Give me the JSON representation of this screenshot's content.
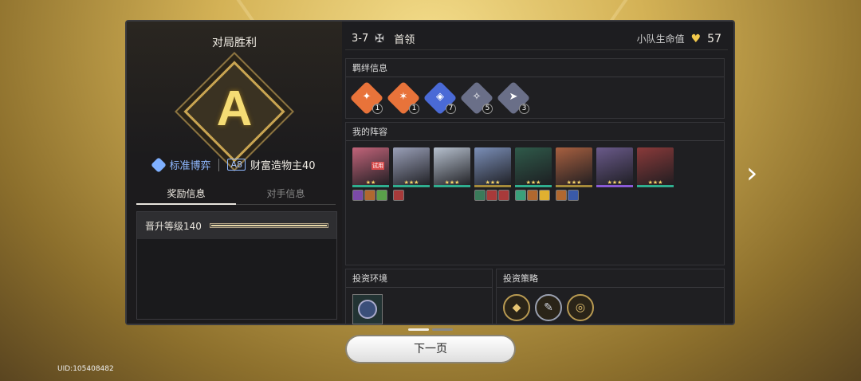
{
  "result": {
    "title": "对局胜利",
    "rank": "A",
    "mode": "标准博弈",
    "difficulty_badge": "A8",
    "difficulty_label": "财富造物主40"
  },
  "tabs": [
    {
      "label": "奖励信息",
      "active": true
    },
    {
      "label": "对手信息",
      "active": false
    }
  ],
  "reward": {
    "label": "晋升等级140",
    "progress": 1.0
  },
  "stage": {
    "number": "3-7",
    "type": "首领",
    "hp_label": "小队生命值",
    "hp_value": "57"
  },
  "bonds": {
    "title": "羁绊信息",
    "items": [
      {
        "count": "1",
        "color": "#e8733a"
      },
      {
        "count": "1",
        "color": "#e8733a"
      },
      {
        "count": "7",
        "color": "#4a6ad6"
      },
      {
        "count": "5",
        "color": "#6a6f88"
      },
      {
        "count": "3",
        "color": "#6a6f88"
      }
    ]
  },
  "lineup": {
    "title": "我的阵容",
    "trial_label": "试用",
    "units": [
      {
        "color": "#c2647a",
        "rarity": "#2fae8f",
        "stars": "★★",
        "items": [
          "#7b4aa8",
          "#b0682f",
          "#5aa04a"
        ],
        "trial": true
      },
      {
        "color": "#9aa0b8",
        "rarity": "#2fae8f",
        "stars": "★★★",
        "items": [
          "#a83a3a"
        ]
      },
      {
        "color": "#b7c1cf",
        "rarity": "#2fae8f",
        "stars": "★★★",
        "items": []
      },
      {
        "color": "#7b8fb8",
        "rarity": "#a58a3a",
        "stars": "★★★",
        "items": [
          "#3a7a5a",
          "#a83a3a",
          "#a83a3a"
        ]
      },
      {
        "color": "#2f5a4a",
        "rarity": "#2fae8f",
        "stars": "★★★",
        "items": [
          "#3aa07a",
          "#b0682f",
          "#e0b030"
        ]
      },
      {
        "color": "#a86040",
        "rarity": "#a58a3a",
        "stars": "★★★",
        "items": [
          "#b0682f",
          "#3a5aa8"
        ]
      },
      {
        "color": "#6a5a8a",
        "rarity": "#8a5ad6",
        "stars": "★★★",
        "items": []
      },
      {
        "color": "#8a3a3a",
        "rarity": "#2fae8f",
        "stars": "★★★",
        "items": []
      }
    ]
  },
  "environment": {
    "title": "投资环境"
  },
  "strategy": {
    "title": "投资策略"
  },
  "next_button": "下一页",
  "uid": "UID:105408482",
  "colors": {
    "accent_gold": "#f2c94c",
    "mode_blue": "#8fb8ff"
  }
}
